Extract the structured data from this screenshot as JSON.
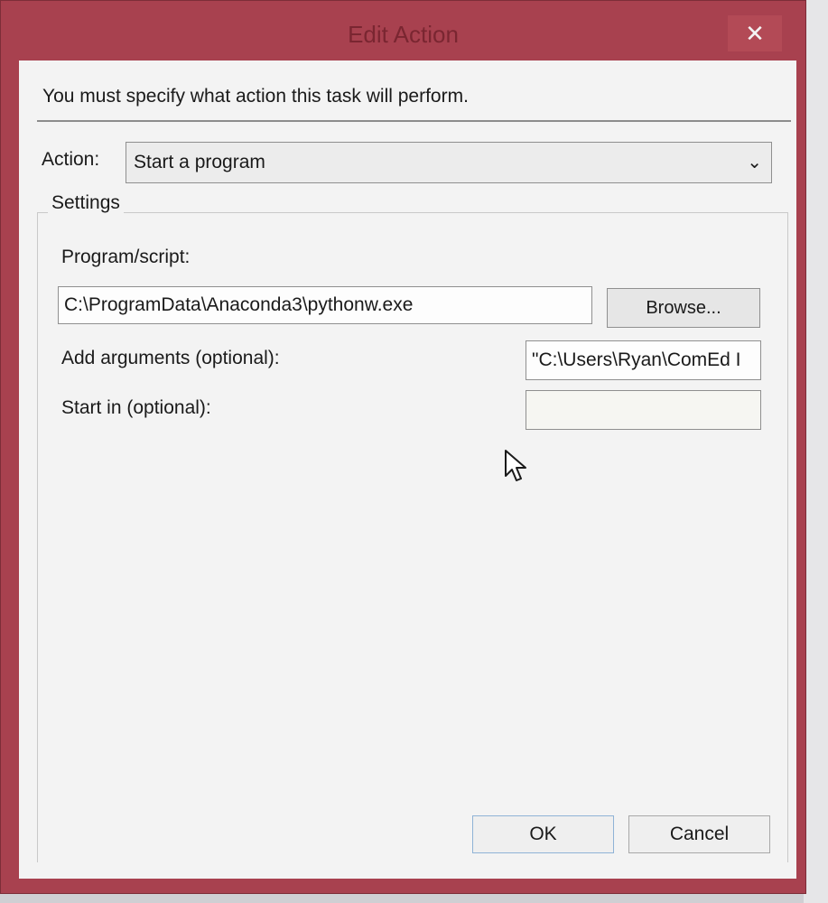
{
  "window": {
    "title": "Edit Action",
    "close_glyph": "✕"
  },
  "dialog": {
    "instruction": "You must specify what action this task will perform.",
    "action_label": "Action:",
    "action_value": "Start a program",
    "action_chevron": "⌄",
    "settings_legend": "Settings",
    "program_label": "Program/script:",
    "program_value": "C:\\ProgramData\\Anaconda3\\pythonw.exe",
    "browse_label": "Browse...",
    "arguments_label": "Add arguments (optional):",
    "arguments_value": "\"C:\\Users\\Ryan\\ComEd I",
    "start_in_label": "Start in (optional):",
    "start_in_value": "",
    "ok_label": "OK",
    "cancel_label": "Cancel"
  },
  "colors": {
    "title_bar": "#a8414f",
    "client_bg": "#f3f3f3",
    "ok_border": "#8fb3d6"
  },
  "icons": {
    "close": "close-icon",
    "dropdown": "chevron-down-icon",
    "pointer": "mouse-pointer-icon"
  }
}
